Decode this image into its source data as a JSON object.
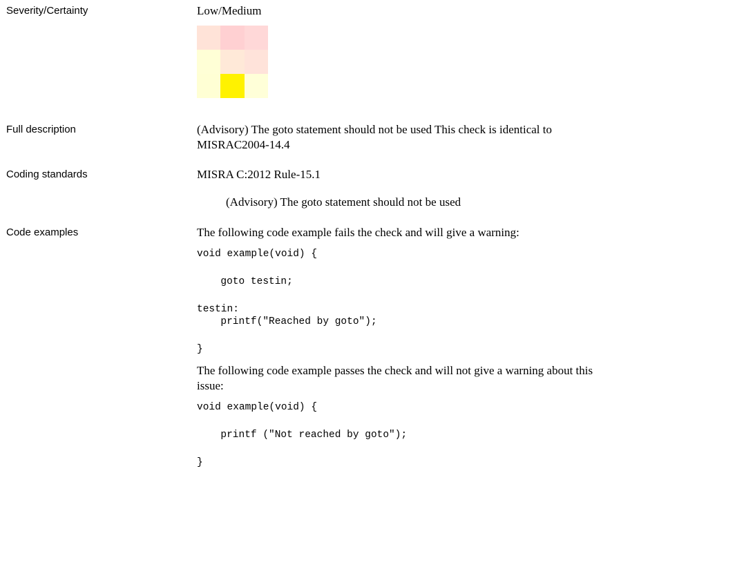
{
  "rows": {
    "severity": {
      "label": "Severity/Certainty",
      "value": "Low/Medium"
    },
    "description": {
      "label": "Full description",
      "line1": "(Advisory) The goto statement should not be used This check is identical to",
      "line2": "MISRAC2004-14.4"
    },
    "standards": {
      "label": "Coding standards",
      "rule": "MISRA C:2012 Rule-15.1",
      "rule_text": "(Advisory) The goto statement should not be used"
    },
    "examples": {
      "label": "Code examples",
      "fail_intro": "The following code example fails the check and will give a warning:",
      "fail_code": [
        "void example(void) {",
        "  goto testin;",
        "testin:",
        "  printf(\"Reached by goto\");",
        "}"
      ],
      "pass_intro_line1": "The following code example passes the check and will not give a warning about this",
      "pass_intro_line2": "issue:",
      "pass_code": [
        "void example(void) {",
        "  printf (\"Not reached by goto\");",
        "}"
      ]
    }
  },
  "severity_matrix": {
    "colors": [
      [
        "#ffe3d8",
        "#ffd0d2",
        "#ffd8d8"
      ],
      [
        "#ffffd6",
        "#ffe9d8",
        "#ffe3da"
      ],
      [
        "#ffffd4",
        "#fff200",
        "#ffffd8"
      ]
    ]
  }
}
